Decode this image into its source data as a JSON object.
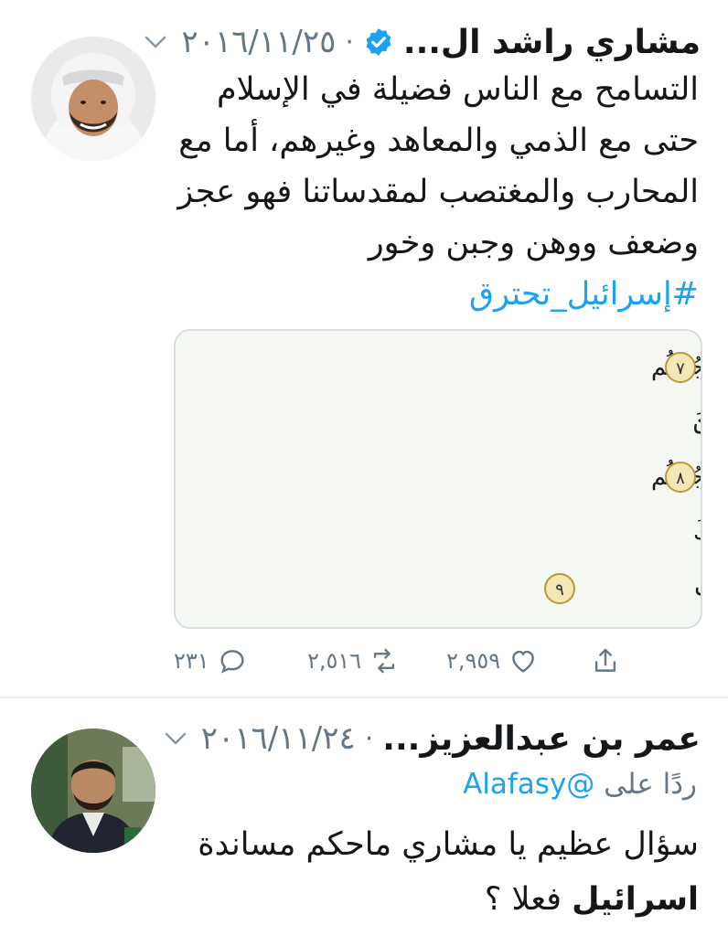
{
  "tweets": [
    {
      "display_name": "مشاري راشد ال...",
      "date": "٢٠١٦/١١/٢٥",
      "separator": "·",
      "text_lines": [
        "التسامح مع الناس فضيلة في الإسلام",
        "حتى مع الذمي والمعاهد وغيرهم، أما مع",
        "المحارب والمغتصب لمقدساتنا فهو عجز",
        "وضعف ووهن وجبن وخور"
      ],
      "hashtag": "#إسرائيل_تحترق",
      "actions": {
        "replies": "٢٣١",
        "retweets": "٢,٥١٦",
        "likes": "٢,٩٥٩"
      },
      "icons": {
        "verified": "verified-badge-icon",
        "menu": "chevron-down-icon"
      },
      "media": {
        "lines": [
          "لَا يَنْهَىٰكُمُ ٱللَّهُ عَنِ ٱلَّذِينَ لَمْ يُقَٰتِلُوكُمْ فِى ٱلدِّينِ وَلَمْ يُخْرِجُوكُم",
          "مِّن دِيَٰرِكُمْ أَن تَبَرُّوهُمْ وَتُقْسِطُوٓا۟ إِلَيْهِمْ ۚ إِنَّ ٱللَّهَ يُحِبُّ ٱلْمُقْسِطِينَ",
          "إِنَّمَا يَنْهَىٰكُمُ ٱللَّهُ عَنِ ٱلَّذِينَ قَٰتَلُوكُمْ فِى ٱلدِّينِ وَأَخْرَجُوكُم",
          "مِّن دِيَٰرِكُمْ وَظَٰهَرُوا۟ عَلَىٰٓ إِخْرَاجِكُمْ أَن تَوَلَّوْهُمْ ۚ وَمَن يَتَوَلَّهُمْ فَأُو۟لَٰٓئِكَ",
          "هُمُ ٱلظَّٰلِمُونَ ۞ يَٰٓأَيُّهَا ٱلَّذِينَ ءَامَنُوٓا۟ إِذَا جَآءَكُمُ ٱلْمُؤْمِنَٰتُ"
        ],
        "verse_numbers": [
          "٧",
          "٨",
          "٩"
        ]
      }
    },
    {
      "display_name": "عمر بن عبدالعزيز...",
      "date": "٢٠١٦/١١/٢٤",
      "separator": "·",
      "reply_prefix": "ردًا على",
      "reply_handle": "@Alafasy",
      "text_line1": "سؤال عظيم يا مشاري ماحكم مساندة",
      "text_bold": "اسرائيل",
      "text_rest": " فعلا ؟"
    }
  ],
  "colors": {
    "link": "#1da1f2",
    "muted": "#657786",
    "text": "#14171a",
    "divider": "#e6ecf0"
  }
}
